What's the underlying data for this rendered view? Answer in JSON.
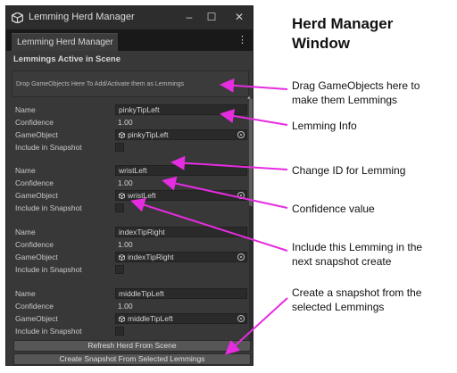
{
  "window": {
    "title": "Lemming Herd Manager",
    "tab": "Lemming Herd Manager",
    "section_title": "Lemmings Active in Scene",
    "drop_hint": "Drop GameObjects Here To Add/Activate them as Lemmings",
    "controls": {
      "minimize": "–",
      "maximize": "☐",
      "close": "✕",
      "menu": "⋮"
    }
  },
  "field_labels": {
    "name": "Name",
    "confidence": "Confidence",
    "gameobject": "GameObject",
    "include": "Include in Snapshot"
  },
  "lemmings": [
    {
      "name": "pinkyTipLeft",
      "confidence": "1.00",
      "gameobject": "pinkyTipLeft",
      "include": false
    },
    {
      "name": "wristLeft",
      "confidence": "1.00",
      "gameobject": "wristLeft",
      "include": false
    },
    {
      "name": "indexTipRight",
      "confidence": "1.00",
      "gameobject": "indexTipRight",
      "include": false
    },
    {
      "name": "middleTipLeft",
      "confidence": "1.00",
      "gameobject": "middleTipLeft",
      "include": false
    }
  ],
  "buttons": {
    "refresh": "Refresh Herd From Scene",
    "snapshot": "Create Snapshot From Selected Lemmings"
  },
  "annotations": {
    "heading_line1": "Herd Manager",
    "heading_line2": "Window",
    "drag_line1": "Drag GameObjects here to",
    "drag_line2": "make them Lemmings",
    "info": "Lemming Info",
    "change_id": "Change ID for Lemming",
    "confidence": "Confidence value",
    "include_line1": "Include this Lemming in the",
    "include_line2": "next snapshot create",
    "snapshot_line1": "Create a snapshot from the",
    "snapshot_line2": "selected Lemmings"
  },
  "colors": {
    "arrow": "#e62ce0",
    "window_bg": "#383838",
    "field_bg": "#2a2a2a",
    "button_bg": "#565656"
  },
  "icons": {
    "app": "unity-logo-icon",
    "gameobject": "cube-icon",
    "picker": "object-picker-icon"
  }
}
